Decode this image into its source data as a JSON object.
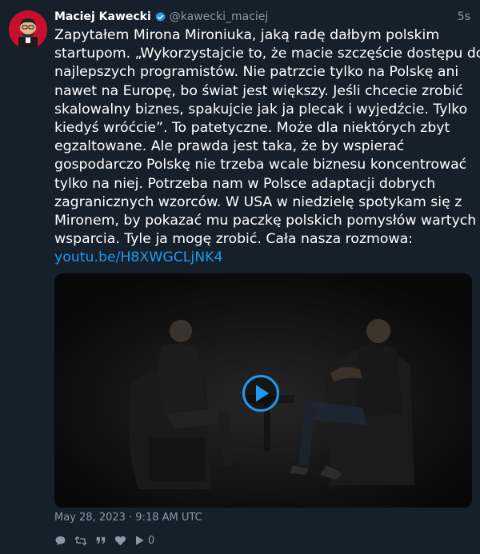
{
  "author": {
    "name": "Maciej Kawecki",
    "handle": "@kawecki_maciej",
    "verified": true
  },
  "time_ago": "5s",
  "text_lines": [
    "Zapytałem Mirona Mironiuka, jaką radę dałbym polskim",
    "startupom. „Wykorzystajcie to, że macie szczęście dostępu do",
    "najlepszych programistów. Nie patrzcie tylko na Polskę ani",
    "nawet na Europę, bo świat jest większy. Jeśli chcecie zrobić",
    "skalowalny biznes, spakujcie jak ja plecak i wyjedźcie. Tylko",
    "kiedyś wróćcie”. To patetyczne. Może dla niektórych zbyt",
    "egzaltowane. Ale prawda jest taka, że by wspierać",
    "gospodarczo Polskę nie trzeba wcale biznesu koncentrować",
    "tylko na niej. Potrzeba nam w Polsce adaptacji dobrych",
    "zagranicznych wzorców. W USA w niedzielę spotykam się z",
    "Mironem, by pokazać mu paczkę polskich pomysłów wartych",
    "wsparcia. Tyle ja mogę zrobić. Cała nasza rozmowa:"
  ],
  "link": "youtu.be/H8XWGCLjNK4",
  "timestamp": "May 28, 2023 · 9:18 AM UTC",
  "actions": {
    "icons": [
      "reply-icon",
      "retweet-icon",
      "quote-icon",
      "like-icon",
      "views-icon"
    ],
    "views_count": "0"
  },
  "colors": {
    "background": "#15202b",
    "text": "#ffffff",
    "muted": "#8b98a5",
    "link": "#1d9bf0",
    "verified": "#1d9bf0"
  }
}
